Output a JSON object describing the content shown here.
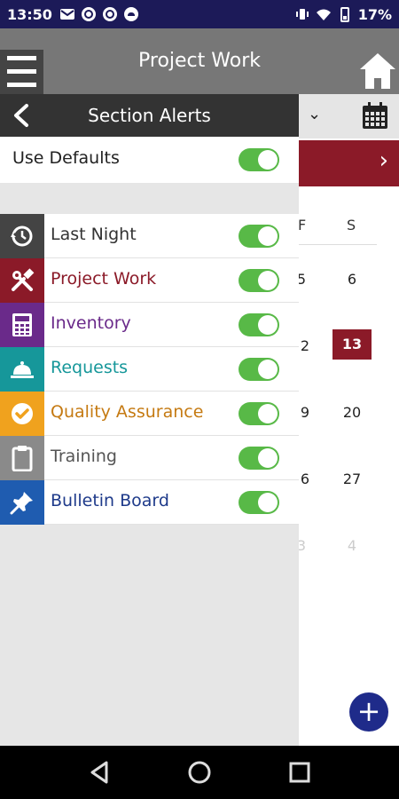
{
  "status_bar": {
    "time": "13:50",
    "battery": "17%"
  },
  "app_header": {
    "title": "Project Work"
  },
  "drawer": {
    "title": "Section Alerts",
    "defaults_label": "Use Defaults",
    "sections": [
      {
        "label": "Last Night",
        "color": "#333333",
        "icon_color": "#444444",
        "icon": "history-icon",
        "enabled": true
      },
      {
        "label": "Project Work",
        "color": "#8b1a28",
        "icon_color": "#8b1a28",
        "icon": "tools-icon",
        "enabled": true
      },
      {
        "label": "Inventory",
        "color": "#6a2a8a",
        "icon_color": "#6a2a8a",
        "icon": "calculator-icon",
        "enabled": true
      },
      {
        "label": "Requests",
        "color": "#16979a",
        "icon_color": "#16979a",
        "icon": "service-bell-icon",
        "enabled": true
      },
      {
        "label": "Quality Assurance",
        "color": "#c57a12",
        "icon_color": "#f0a21e",
        "icon": "check-circle-icon",
        "enabled": true
      },
      {
        "label": "Training",
        "color": "#555555",
        "icon_color": "#8a8a8a",
        "icon": "clipboard-icon",
        "enabled": true
      },
      {
        "label": "Bulletin Board",
        "color": "#1e3a8a",
        "icon_color": "#1f5cb0",
        "icon": "pushpin-icon",
        "enabled": true
      }
    ]
  },
  "calendar": {
    "weekdays": [
      "F",
      "S"
    ],
    "rows": [
      [
        "5",
        "6"
      ],
      [
        "2",
        "13"
      ],
      [
        "9",
        "20"
      ],
      [
        "6",
        "27"
      ],
      [
        "3",
        "4"
      ]
    ]
  },
  "colors": {
    "toggle_on": "#58b947",
    "accent": "#8b1a28",
    "fab": "#1f2b8a"
  }
}
